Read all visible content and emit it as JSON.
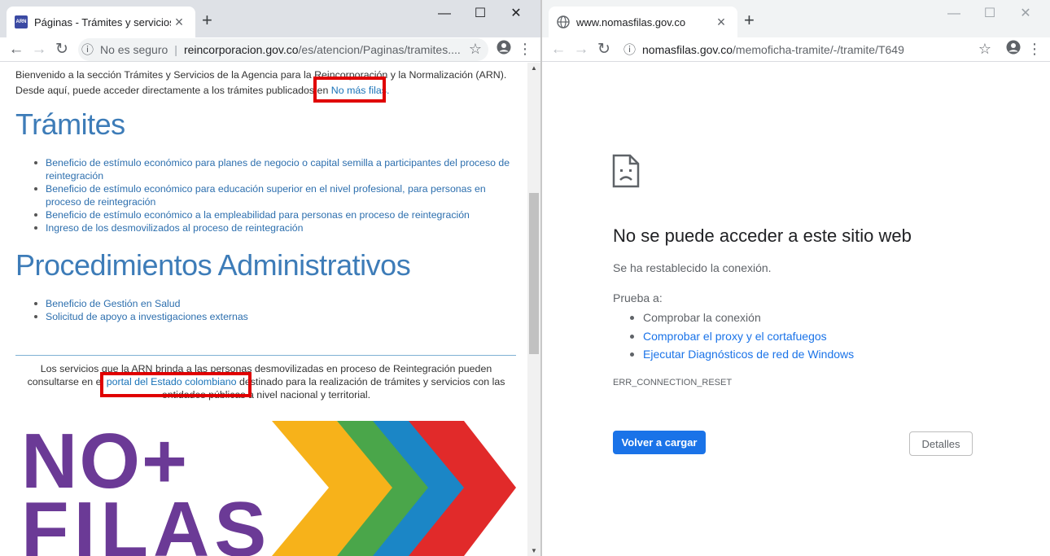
{
  "left_window": {
    "tab": {
      "favicon_text": "ARN",
      "title": "Páginas - Trámites y servicios",
      "close": "×"
    },
    "newtab": "+",
    "controls": {
      "minimize": "—",
      "maximize": "☐",
      "close": "✕"
    },
    "toolbar": {
      "back": "←",
      "forward": "→",
      "reload": "↻",
      "security_label": "No es seguro",
      "separator": "|",
      "url_host": "reincorporacion.gov.co",
      "url_path": "/es/atencion/Paginas/tramites....",
      "star": "☆",
      "menu": "⋮"
    },
    "intro": {
      "line1": "Bienvenido a la sección Trámites y Servicios de la Agencia para la Reincorporación y la Normalización (ARN).",
      "line2_prefix": "Desde aquí, puede acceder directamente a los trámites publicados en ",
      "line2_link": "No más filas."
    },
    "tramites": {
      "heading": "Trámites",
      "items": [
        "Beneficio de estímulo económico para planes de negocio o capital semilla a participantes del proceso de reintegración",
        "Beneficio de estímulo económico para educación superior en el nivel profesional, para personas en proceso de reintegración",
        "Beneficio de estímulo económico a la empleabilidad para personas en proceso de reintegración",
        "Ingreso de los desmovilizados al proceso de reintegración"
      ]
    },
    "procedimientos": {
      "heading": "Procedimientos Administrativos",
      "items": [
        "Beneficio de Gestión en Salud",
        "Solicitud de apoyo a investigaciones externas"
      ]
    },
    "footer": {
      "prefix": "Los servicios que la ARN brinda a las personas desmovilizadas en proceso de Reintegración pueden consultarse en el ",
      "link": "portal del Estado colombiano",
      "suffix": " destinado para la realización de trámites y servicios con las entidades públicas a nivel nacional y territorial."
    },
    "logo": {
      "line1": "NO+",
      "line2": "FILAS"
    },
    "colors": {
      "heading": "#3d7cb8",
      "link": "#1a73b8",
      "highlight": "#e00000",
      "logo_purple": "#6b3a96"
    }
  },
  "right_window": {
    "tab": {
      "title": "www.nomasfilas.gov.co",
      "close": "×"
    },
    "newtab": "+",
    "controls": {
      "minimize": "—",
      "maximize": "☐",
      "close": "✕"
    },
    "toolbar": {
      "back": "←",
      "forward": "→",
      "reload": "↻",
      "url_host": "nomasfilas.gov.co",
      "url_path": "/memoficha-tramite/-/tramite/T649",
      "star": "☆",
      "menu": "⋮"
    },
    "error": {
      "title": "No se puede acceder a este sitio web",
      "subtitle": "Se ha restablecido la conexión.",
      "try_label": "Prueba a:",
      "suggestions": [
        {
          "text": "Comprobar la conexión",
          "link": false
        },
        {
          "text": "Comprobar el proxy y el cortafuegos",
          "link": true
        },
        {
          "text": "Ejecutar Diagnósticos de red de Windows",
          "link": true
        }
      ],
      "code": "ERR_CONNECTION_RESET",
      "reload_button": "Volver a cargar",
      "details_button": "Detalles"
    },
    "colors": {
      "primary": "#1a73e8"
    }
  }
}
